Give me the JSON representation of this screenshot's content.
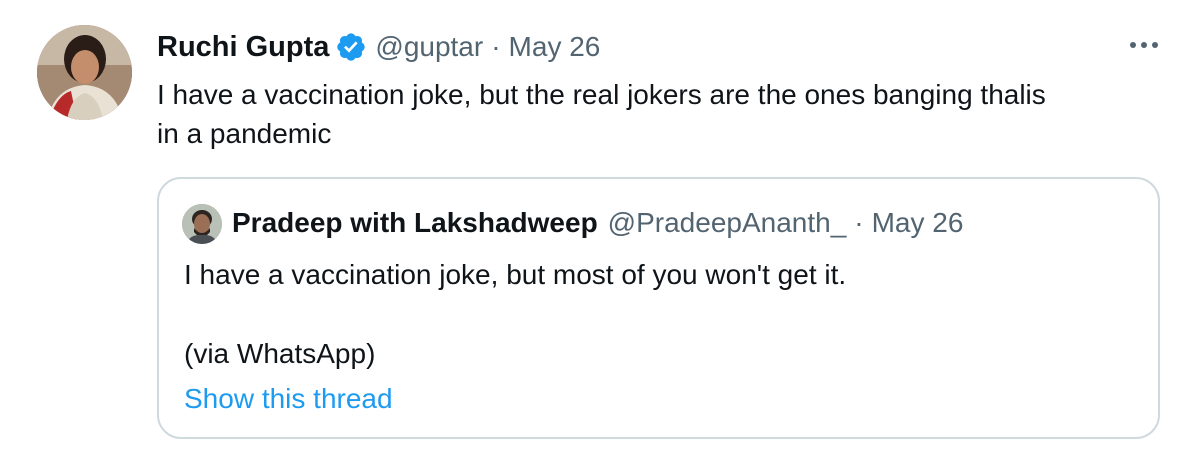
{
  "tweet": {
    "author": {
      "name": "Ruchi Gupta",
      "handle": "@guptar",
      "verified": true
    },
    "separator": "·",
    "date": "May 26",
    "text_line1": "I have a vaccination joke, but the real jokers are the ones banging thalis",
    "text_line2": "in a pandemic",
    "more_icon": "more-horizontal-icon"
  },
  "quoted_tweet": {
    "author": {
      "name": "Pradeep with Lakshadweep",
      "handle": "@PradeepAnanth_"
    },
    "separator": "·",
    "date": "May 26",
    "text_line1": "I have a vaccination joke, but most of you won't get it.",
    "text_line2": "(via WhatsApp)",
    "show_thread_label": "Show this thread"
  },
  "colors": {
    "text_primary": "#0f1419",
    "text_secondary": "#536471",
    "link": "#1d9bf0",
    "verified_badge": "#1d9bf0",
    "quote_border": "#cfd9de"
  }
}
